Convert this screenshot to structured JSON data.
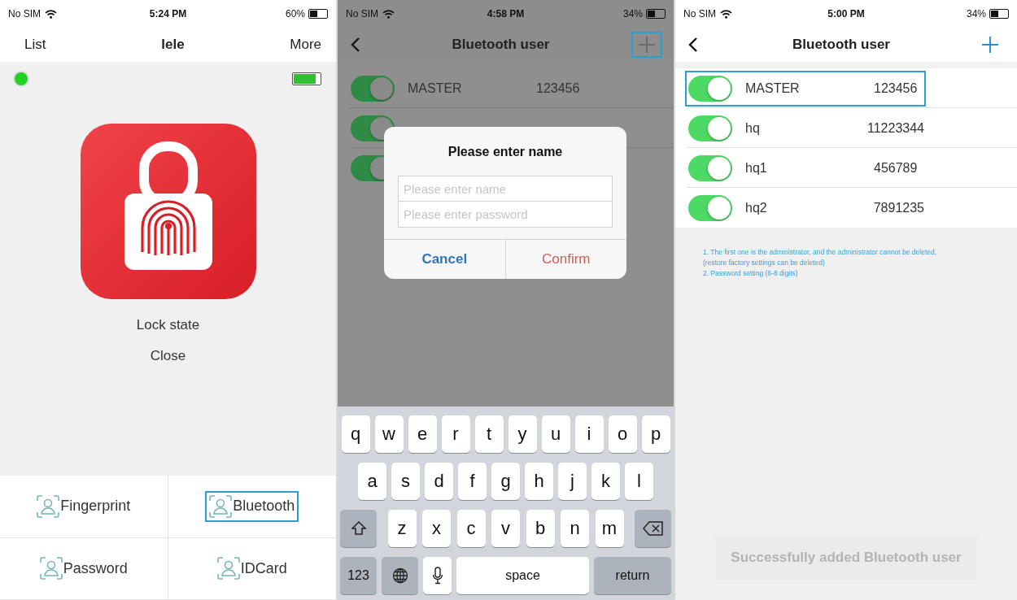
{
  "screens": [
    {
      "kind": "lock",
      "status_bar": {
        "carrier": "No SIM",
        "time": "5:24 PM",
        "battery": "60%"
      },
      "nav": {
        "left": "List",
        "title": "lele",
        "right": "More"
      },
      "connected": true,
      "lock_state_label": "Lock state",
      "lock_state": "Close",
      "menu": [
        {
          "label": "Fingerprint",
          "highlighted": false
        },
        {
          "label": "Bluetooth",
          "highlighted": true
        },
        {
          "label": "Password",
          "highlighted": false
        },
        {
          "label": "IDCard",
          "highlighted": false
        }
      ]
    },
    {
      "kind": "users",
      "status_bar": {
        "carrier": "No SIM",
        "time": "4:58 PM",
        "battery": "34%"
      },
      "nav": {
        "title": "Bluetooth user",
        "add_highlighted": true
      },
      "users": [
        {
          "name": "MASTER",
          "password": "123456",
          "enabled": true,
          "highlighted": false
        },
        {
          "enabled": true,
          "highlighted": false
        },
        {
          "enabled": true,
          "highlighted": false
        }
      ],
      "dialog": {
        "title": "Please enter name",
        "fields": [
          {
            "placeholder": "Please enter name"
          },
          {
            "placeholder": "Please enter password"
          }
        ],
        "buttons": [
          "Cancel",
          "Confirm"
        ]
      },
      "keyboard": {
        "rows": [
          [
            {
              "kind": "letter",
              "label": "q"
            },
            {
              "kind": "letter",
              "label": "w"
            },
            {
              "kind": "letter",
              "label": "e"
            },
            {
              "kind": "letter",
              "label": "r"
            },
            {
              "kind": "letter",
              "label": "t"
            },
            {
              "kind": "letter",
              "label": "y"
            },
            {
              "kind": "letter",
              "label": "u"
            },
            {
              "kind": "letter",
              "label": "i"
            },
            {
              "kind": "letter",
              "label": "o"
            },
            {
              "kind": "letter",
              "label": "p"
            }
          ],
          [
            {
              "kind": "letter",
              "label": "a"
            },
            {
              "kind": "letter",
              "label": "s"
            },
            {
              "kind": "letter",
              "label": "d"
            },
            {
              "kind": "letter",
              "label": "f"
            },
            {
              "kind": "letter",
              "label": "g"
            },
            {
              "kind": "letter",
              "label": "h"
            },
            {
              "kind": "letter",
              "label": "j"
            },
            {
              "kind": "letter",
              "label": "k"
            },
            {
              "kind": "letter",
              "label": "l"
            }
          ],
          [
            {
              "kind": "shift"
            },
            {
              "kind": "letter",
              "label": "z"
            },
            {
              "kind": "letter",
              "label": "x"
            },
            {
              "kind": "letter",
              "label": "c"
            },
            {
              "kind": "letter",
              "label": "v"
            },
            {
              "kind": "letter",
              "label": "b"
            },
            {
              "kind": "letter",
              "label": "n"
            },
            {
              "kind": "letter",
              "label": "m"
            },
            {
              "kind": "delete"
            }
          ]
        ],
        "bottom_keys": [
          {
            "kind": "mode",
            "label": "123"
          },
          {
            "kind": "globe"
          },
          {
            "kind": "mic"
          },
          {
            "kind": "space",
            "label": "space"
          },
          {
            "kind": "return",
            "label": "return"
          }
        ]
      }
    },
    {
      "kind": "users",
      "status_bar": {
        "carrier": "No SIM",
        "time": "5:00 PM",
        "battery": "34%"
      },
      "nav": {
        "title": "Bluetooth user",
        "add_highlighted": false
      },
      "users": [
        {
          "name": "MASTER",
          "password": "123456",
          "enabled": true,
          "highlighted": true
        },
        {
          "name": "hq",
          "password": "11223344",
          "enabled": true,
          "highlighted": false
        },
        {
          "name": "hq1",
          "password": "456789",
          "enabled": true,
          "highlighted": false
        },
        {
          "name": "hq2",
          "password": "7891235",
          "enabled": true,
          "highlighted": false
        }
      ],
      "notes": [
        "1. The first one is the administrator, and the administrator cannot be deleted, (restore factory settings can be deleted)",
        "2. Password setting (6-8 digits)"
      ],
      "toast": "Successfully added Bluetooth user"
    }
  ]
}
